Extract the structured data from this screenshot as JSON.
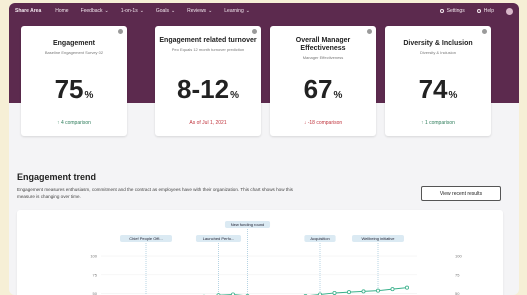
{
  "nav": {
    "brand": "Share Area",
    "items": [
      "Home",
      "Feedback",
      "1-on-1s",
      "Goals",
      "Reviews",
      "Learning"
    ],
    "settings": "Settings",
    "help": "Help"
  },
  "cards": [
    {
      "title": "Engagement",
      "subtitle": "Baseline Engagement Survey 02",
      "value": "75",
      "unit": "%",
      "footer": "4 comparison",
      "footer_icon": "arrow-up-icon",
      "footer_color": "#2e7d5b"
    },
    {
      "title": "Engagement related turnover",
      "subtitle": "Peo Equals 12 month turnover prediction",
      "value": "8-12",
      "unit": "%",
      "footer": "As of Jul 1, 2021",
      "footer_icon": "",
      "footer_color": "#c0343d"
    },
    {
      "title": "Overall Manager Effectiveness",
      "subtitle": "Manager Effectiveness",
      "value": "67",
      "unit": "%",
      "footer": "-18 comparison",
      "footer_icon": "arrow-down-icon",
      "footer_color": "#c0343d"
    },
    {
      "title": "Diversity & Inclusion",
      "subtitle": "Diversity & Inclusion",
      "value": "74",
      "unit": "%",
      "footer": "1 comparison",
      "footer_icon": "arrow-up-icon",
      "footer_color": "#2e7d5b"
    }
  ],
  "trend": {
    "title": "Engagement trend",
    "description": "Engagement measures enthusiasm, commitment and the contract as employees have with their organization. This chart shows how this measure is changing over time.",
    "button": "View recent results"
  },
  "chart_data": {
    "type": "line",
    "ylabel": "",
    "yticks": [
      "100",
      "75",
      "50"
    ],
    "right_yticks": [
      "100",
      "75",
      "50"
    ],
    "y_domain": [
      35,
      100
    ],
    "values": [
      44,
      42,
      40,
      41,
      43,
      44,
      46,
      48,
      49,
      47,
      45,
      43,
      45,
      47,
      49,
      51,
      52,
      53,
      54,
      56,
      58
    ],
    "annotations": [
      {
        "label": "Chief People Offi...",
        "index": 2
      },
      {
        "label": "Launched Perfo...",
        "index": 7
      },
      {
        "label": "New funding round",
        "index": 9
      },
      {
        "label": "Acquisition",
        "index": 14
      },
      {
        "label": "Wellbeing initiative",
        "index": 18
      }
    ],
    "line_color": "#38b08a",
    "marker_color": "#38b08a"
  }
}
